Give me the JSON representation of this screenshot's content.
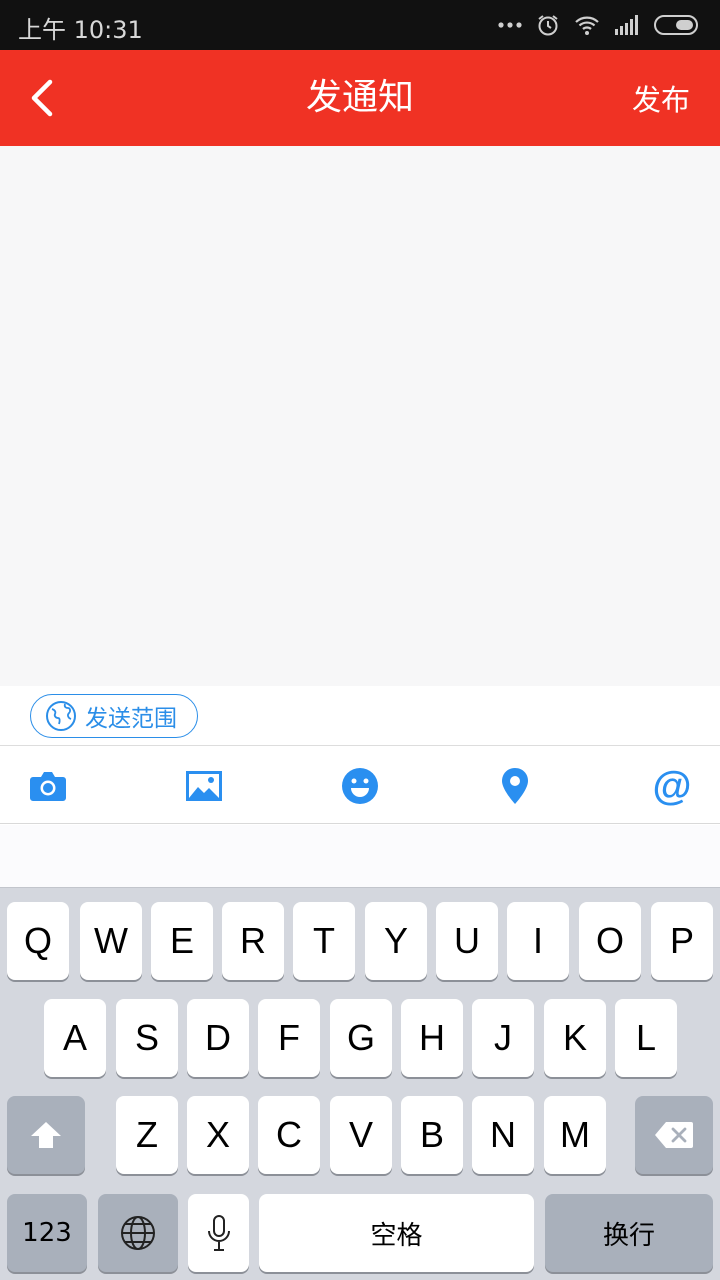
{
  "status_bar": {
    "time": "上午 10:31",
    "icons": [
      "more-dots-icon",
      "alarm-icon",
      "wifi-icon",
      "signal-icon",
      "battery-icon"
    ]
  },
  "header": {
    "title": "发通知",
    "publish_label": "发布",
    "background_color": "#f03224"
  },
  "compose": {
    "placeholder": ""
  },
  "scope_button": {
    "label": "发送范围",
    "accent_color": "#2b8ee8"
  },
  "toolbar": {
    "items": [
      "camera-icon",
      "picture-icon",
      "emoji-icon",
      "location-icon",
      "mention-icon"
    ],
    "mention_label": "@",
    "icon_color": "#2a8ff0"
  },
  "keyboard": {
    "row1": [
      "Q",
      "W",
      "E",
      "R",
      "T",
      "Y",
      "U",
      "I",
      "O",
      "P"
    ],
    "row2": [
      "A",
      "S",
      "D",
      "F",
      "G",
      "H",
      "J",
      "K",
      "L"
    ],
    "row3": [
      "Z",
      "X",
      "C",
      "V",
      "B",
      "N",
      "M"
    ],
    "numbers_label": "123",
    "space_label": "空格",
    "return_label": "换行"
  }
}
